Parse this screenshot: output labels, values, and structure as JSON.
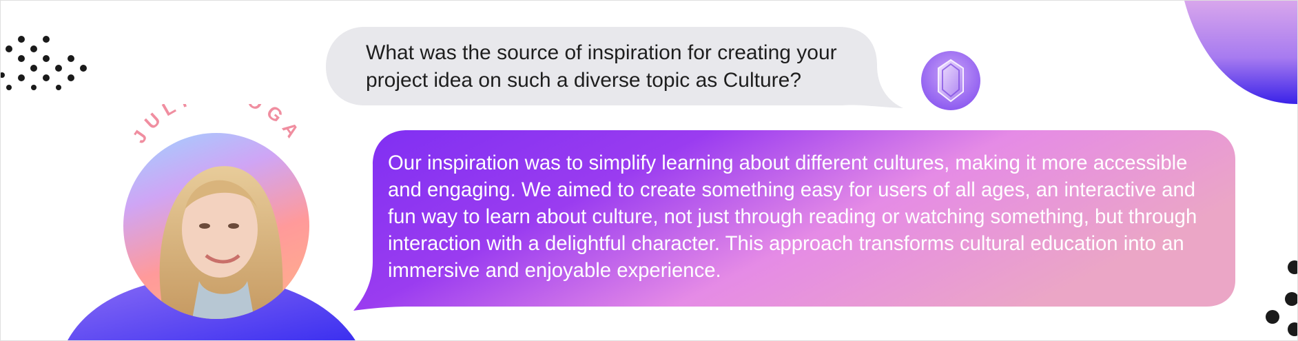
{
  "conversation": {
    "question": "What was the source of inspiration for creating your project idea on such a diverse topic as Culture?",
    "answer": "Our inspiration was to simplify learning about different cultures, making it more accessible and engaging. We aimed to create something easy for users of all ages, an interactive and fun way to learn about culture, not just through reading or watching something, but through interaction with a delightful character. This approach transforms cultural education into an immersive and enjoyable experience."
  },
  "interviewee": {
    "name": "JULIA ROGA"
  },
  "icons": {
    "assistant_badge": "gem-icon"
  },
  "colors": {
    "question_bubble": "#e8e8ec",
    "answer_gradient_start": "#7b2ff0",
    "answer_gradient_end": "#eba6c6",
    "name_text": "#f08ea0",
    "accent_blue": "#3b2ff0"
  }
}
